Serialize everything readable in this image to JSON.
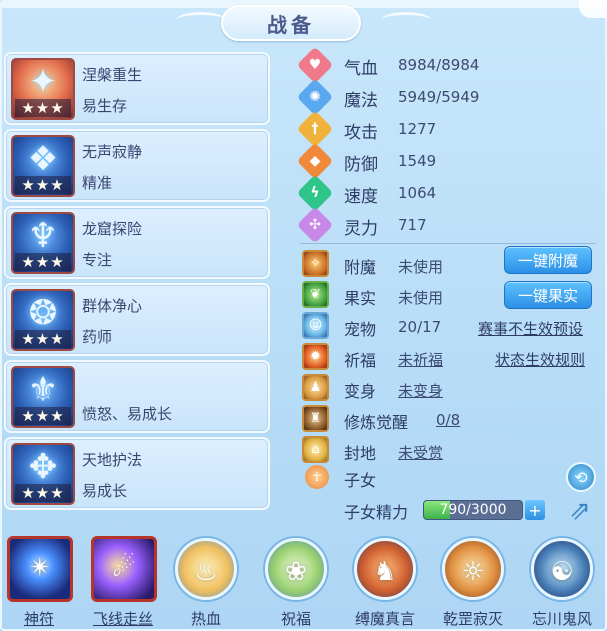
{
  "title": "战备",
  "equipment": [
    {
      "name": "涅槃重生",
      "trait": "易生存",
      "stars": "★★★",
      "icon": "popsicle-icon"
    },
    {
      "name": "无声寂静",
      "trait": "精准",
      "stars": "★★★",
      "icon": "blue-armor-icon"
    },
    {
      "name": "龙窟探险",
      "trait": "专注",
      "stars": "★★★",
      "icon": "dragon-armor-icon"
    },
    {
      "name": "群体净心",
      "trait": "药师",
      "stars": "★★★",
      "icon": "wave-armor-icon"
    },
    {
      "name": "",
      "trait": "愤怒、易成长",
      "stars": "★★★",
      "icon": "helm-armor-icon"
    },
    {
      "name": "天地护法",
      "trait": "易成长",
      "stars": "★★★",
      "icon": "guardian-armor-icon"
    }
  ],
  "attributes": [
    {
      "label": "气血",
      "value": "8984/8984",
      "icon": "heart-icon",
      "color": "#f07a8a"
    },
    {
      "label": "魔法",
      "value": "5949/5949",
      "icon": "magic-icon",
      "color": "#5aa8f0"
    },
    {
      "label": "攻击",
      "value": "1277",
      "icon": "sword-icon",
      "color": "#f0b23a"
    },
    {
      "label": "防御",
      "value": "1549",
      "icon": "shield-icon",
      "color": "#f08a3a"
    },
    {
      "label": "速度",
      "value": "1064",
      "icon": "lightning-icon",
      "color": "#2ec48a"
    },
    {
      "label": "灵力",
      "value": "717",
      "icon": "spirit-icon",
      "color": "#c888e8"
    }
  ],
  "status": [
    {
      "label": "附魔",
      "value": "未使用",
      "underline": false,
      "icon": "enchant-icon"
    },
    {
      "label": "果实",
      "value": "未使用",
      "underline": false,
      "icon": "fruit-icon"
    },
    {
      "label": "宠物",
      "value": "20/17",
      "underline": false,
      "icon": "pet-icon"
    },
    {
      "label": "祈福",
      "value": "未祈福",
      "underline": true,
      "icon": "pray-icon"
    },
    {
      "label": "变身",
      "value": "未变身",
      "underline": true,
      "icon": "transform-icon"
    },
    {
      "label": "修炼觉醒",
      "value": "0/8",
      "underline": true,
      "icon": "cultivate-icon"
    },
    {
      "label": "封地",
      "value": "未受赏",
      "underline": true,
      "icon": "fief-icon"
    }
  ],
  "buttons": {
    "enchant": "一键附魔",
    "fruit": "一键果实"
  },
  "links": {
    "preset": "赛事不生效预设",
    "rules": "状态生效规则"
  },
  "children": {
    "label": "子女",
    "energy_label": "子女精力",
    "energy_value": "790/3000",
    "energy_fraction": 0.263
  },
  "skills": [
    {
      "label": "神符",
      "style": "square",
      "underline": true,
      "icon": "rune-icon"
    },
    {
      "label": "飞线走丝",
      "style": "square-b",
      "underline": true,
      "icon": "thread-icon"
    },
    {
      "label": "热血",
      "style": "round",
      "underline": false,
      "icon": "hot-blood-icon",
      "color": "#f0c060"
    },
    {
      "label": "祝福",
      "style": "round",
      "underline": false,
      "icon": "bless-icon",
      "color": "#9ad070"
    },
    {
      "label": "缚魔真言",
      "style": "round",
      "underline": false,
      "icon": "bind-demon-icon",
      "color": "#d06030"
    },
    {
      "label": "乾罡寂灭",
      "style": "round",
      "underline": false,
      "icon": "qiangang-icon",
      "color": "#e09040"
    },
    {
      "label": "忘川鬼风",
      "style": "round",
      "underline": false,
      "icon": "ghost-wind-icon",
      "color": "#4a80b8"
    }
  ]
}
